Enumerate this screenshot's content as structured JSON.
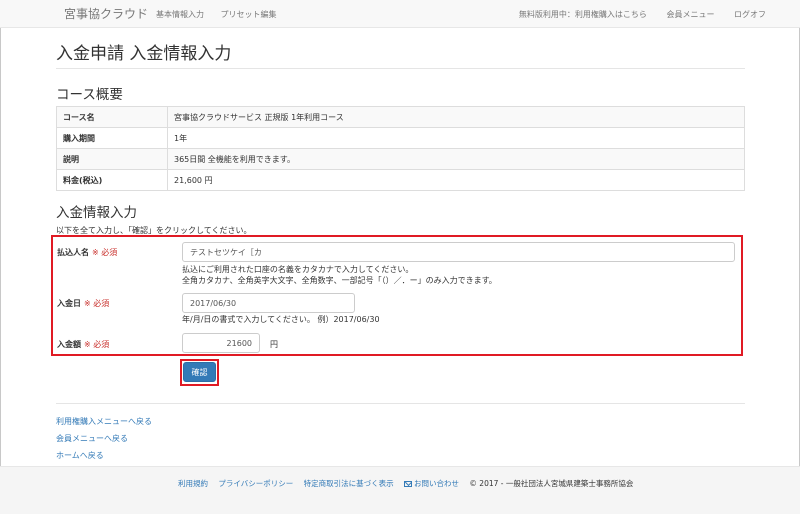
{
  "navbar": {
    "brand": "宮事協クラウド",
    "left_items": [
      "基本情報入力",
      "プリセット編集"
    ],
    "right_items": [
      "無料版利用中：利用権購入はこちら",
      "会員メニュー",
      "ログオフ"
    ]
  },
  "page_title": "入金申請 入金情報入力",
  "summary": {
    "title": "コース概要",
    "rows": [
      {
        "label": "コース名",
        "value": "宮事協クラウドサービス 正規版 1年利用コース"
      },
      {
        "label": "購入期間",
        "value": "1年"
      },
      {
        "label": "説明",
        "value": "365日間 全機能を利用できます。"
      },
      {
        "label": "料金(税込)",
        "value": "21,600 円"
      }
    ]
  },
  "form": {
    "title": "入金情報入力",
    "intro": "以下を全て入力し、「確認」をクリックしてください。",
    "required_mark": "※ 必須",
    "payer_name": {
      "label": "払込人名",
      "value": "テストセツケイ［カ",
      "help_line1": "払込にご利用された口座の名義をカタカナで入力してください。",
      "help_line2": "全角カタカナ、全角英字大文字、全角数字、一部記号「（）／．ー」のみ入力できます。"
    },
    "payment_date": {
      "label": "入金日",
      "value": "2017/06/30",
      "help": "年/月/日の書式で入力してください。 例）2017/06/30"
    },
    "amount": {
      "label": "入金額",
      "value": "21600",
      "unit": "円"
    },
    "confirm_label": "確認"
  },
  "links": [
    "利用権購入メニューへ戻る",
    "会員メニューへ戻る",
    "ホームへ戻る"
  ],
  "footer": {
    "links": [
      "利用規約",
      "プライバシーポリシー",
      "特定商取引法に基づく表示",
      "お問い合わせ"
    ],
    "copyright": "© 2017 - 一般社団法人宮城県建築士事務所協会"
  }
}
